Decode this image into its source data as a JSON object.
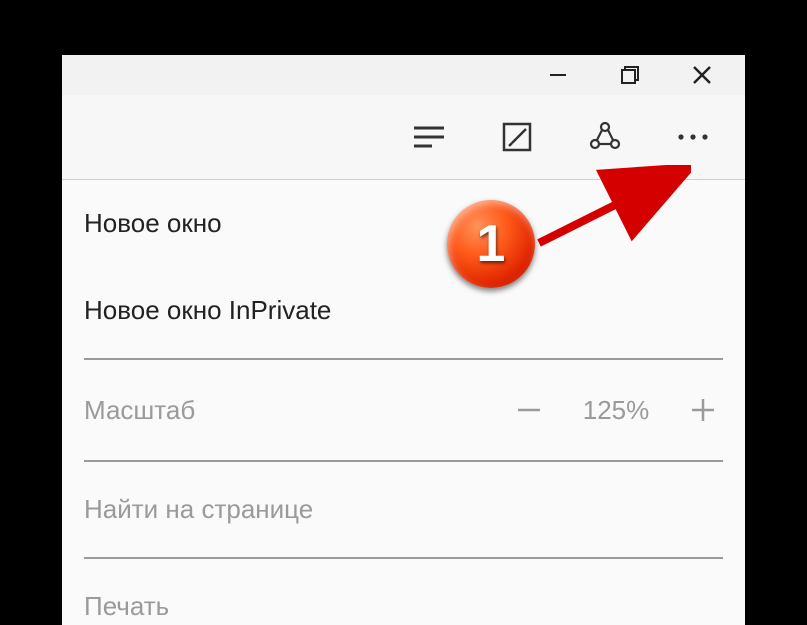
{
  "menu": {
    "new_window": "Новое окно",
    "new_inprivate": "Новое окно InPrivate",
    "zoom_label": "Масштаб",
    "zoom_value": "125%",
    "find": "Найти на странице",
    "print": "Печать"
  },
  "annotation": {
    "badge": "1"
  }
}
